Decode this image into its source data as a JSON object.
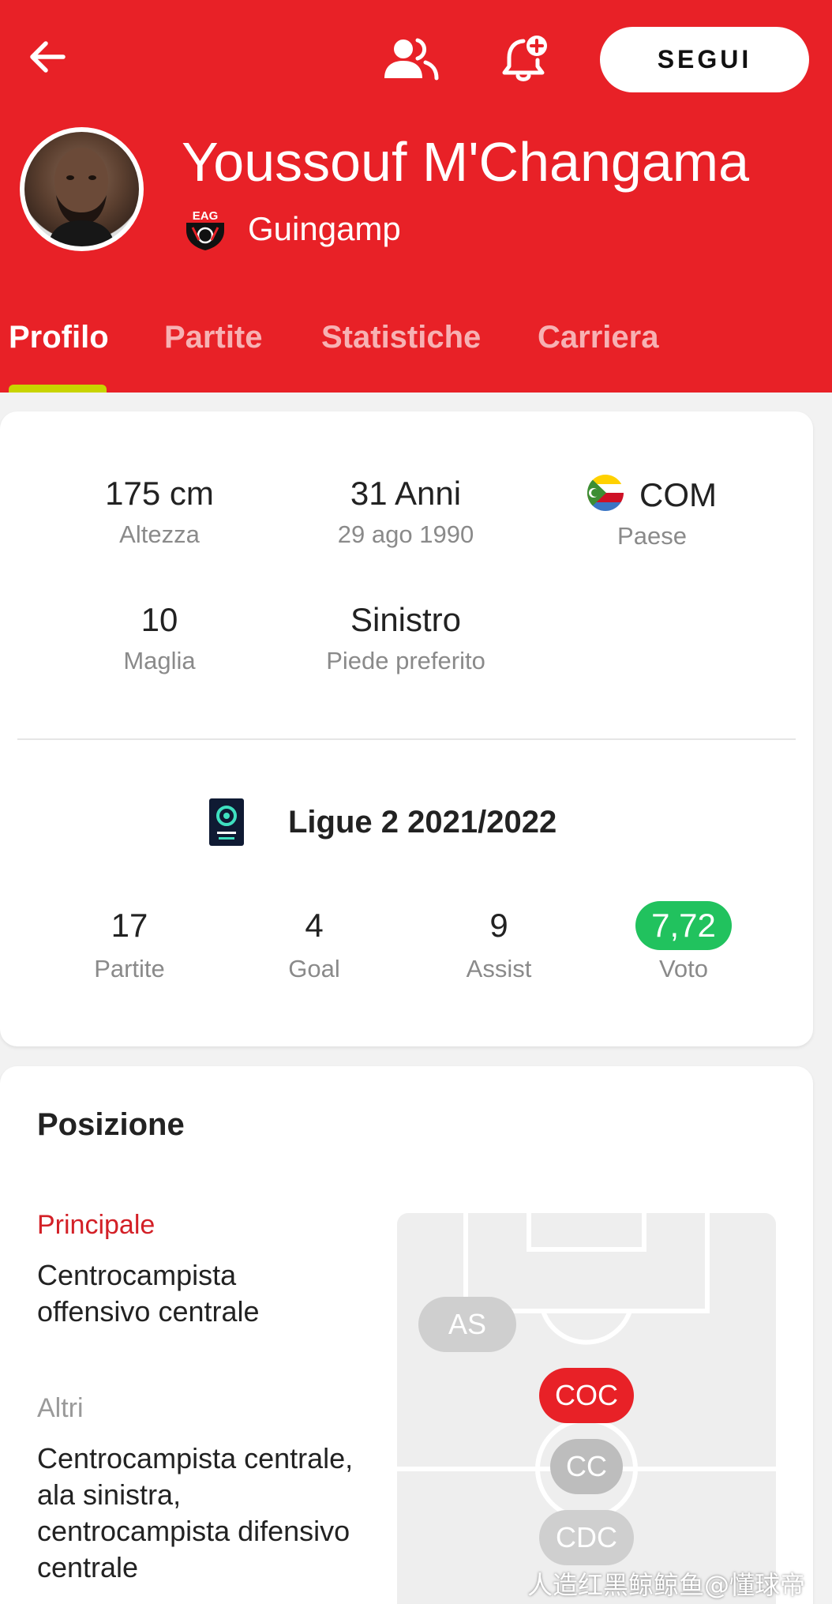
{
  "header": {
    "follow_label": "SEGUI",
    "player_name": "Youssouf M'Changama",
    "club_name": "Guingamp",
    "accent_color": "#e82127",
    "icons": [
      "back-arrow-icon",
      "people-icon",
      "bell-plus-icon"
    ]
  },
  "tabs": [
    {
      "label": "Profilo",
      "active": true
    },
    {
      "label": "Partite",
      "active": false
    },
    {
      "label": "Statistiche",
      "active": false
    },
    {
      "label": "Carriera",
      "active": false
    }
  ],
  "profile": {
    "height": {
      "value": "175 cm",
      "label": "Altezza"
    },
    "age": {
      "value": "31 Anni",
      "label": "29 ago 1990"
    },
    "country": {
      "value": "COM",
      "label": "Paese"
    },
    "shirt": {
      "value": "10",
      "label": "Maglia"
    },
    "foot": {
      "value": "Sinistro",
      "label": "Piede preferito"
    }
  },
  "league": {
    "title": "Ligue 2 2021/2022",
    "stats": [
      {
        "value": "17",
        "label": "Partite"
      },
      {
        "value": "4",
        "label": "Goal"
      },
      {
        "value": "9",
        "label": "Assist"
      },
      {
        "value": "7,72",
        "label": "Voto"
      }
    ],
    "rating_color": "#21c25e"
  },
  "position": {
    "title": "Posizione",
    "main_label": "Principale",
    "main_value": "Centrocampista offensivo centrale",
    "other_label": "Altri",
    "other_value": "Centrocampista centrale, ala sinistra, centrocampista difensivo centrale",
    "chips": {
      "as": "AS",
      "coc": "COC",
      "cc": "CC",
      "cdc": "CDC"
    }
  },
  "watermark": "人造红黑鲸鲸鱼@懂球帝"
}
